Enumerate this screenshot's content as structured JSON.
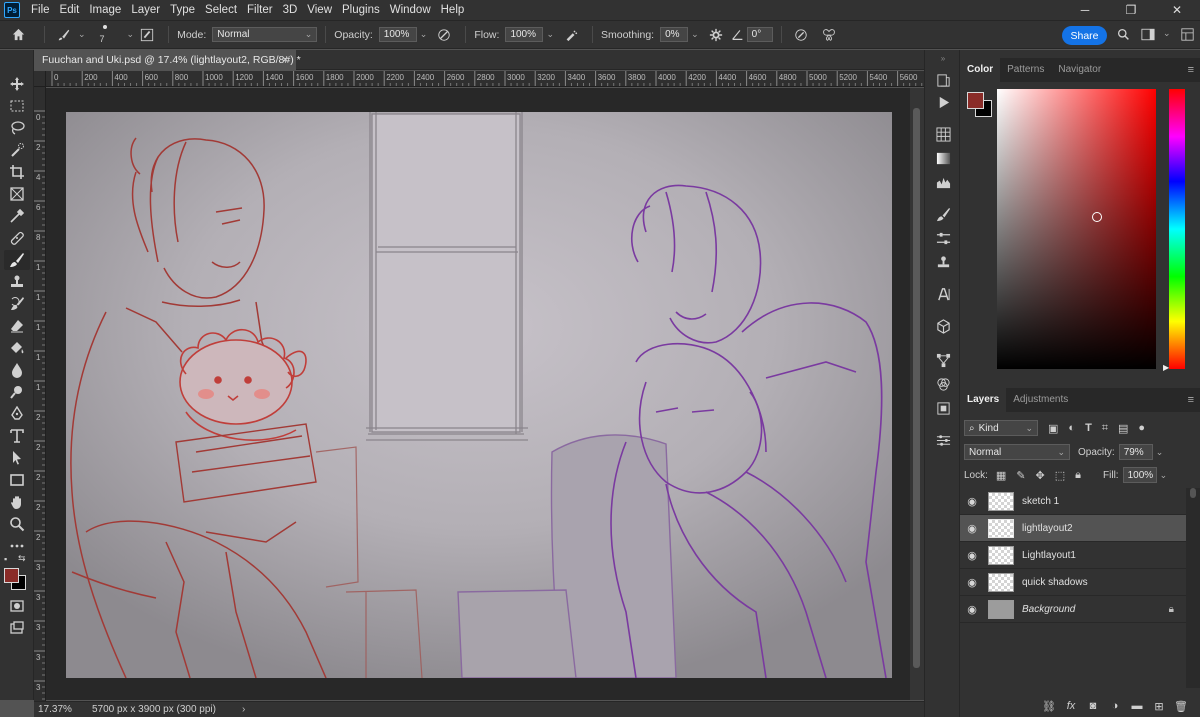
{
  "app": {
    "logo_text": "Ps",
    "menu": [
      "File",
      "Edit",
      "Image",
      "Layer",
      "Type",
      "Select",
      "Filter",
      "3D",
      "View",
      "Plugins",
      "Window",
      "Help"
    ]
  },
  "window_controls": {
    "minimize": "─",
    "maximize": "❐",
    "close": "✕"
  },
  "options_bar": {
    "brush_size": "7",
    "mode_label": "Mode:",
    "mode_value": "Normal",
    "opacity_label": "Opacity:",
    "opacity_value": "100%",
    "flow_label": "Flow:",
    "flow_value": "100%",
    "smoothing_label": "Smoothing:",
    "smoothing_value": "0%",
    "angle_value": "0°",
    "share_label": "Share"
  },
  "document": {
    "tab_title": "Fuuchan and Uki.psd @ 17.4% (lightlayout2, RGB/8#) *",
    "close_glyph": "×"
  },
  "ruler_h_labels": [
    "0",
    "200",
    "400",
    "600",
    "800",
    "1000",
    "1200",
    "1400",
    "1600",
    "1800",
    "2000",
    "2200",
    "2400",
    "2600",
    "2800",
    "3000",
    "3200",
    "3400",
    "3600",
    "3800",
    "4000",
    "4200",
    "4400",
    "4600",
    "4800",
    "5000",
    "5200",
    "5400",
    "5600"
  ],
  "ruler_v_labels": [
    "0",
    "2",
    "4",
    "6",
    "8",
    "1",
    "1",
    "1",
    "1",
    "1",
    "2",
    "2",
    "2",
    "2",
    "2",
    "3",
    "3",
    "3",
    "3",
    "3"
  ],
  "status": {
    "zoom": "17.37%",
    "doc_info": "5700 px x 3900 px (300 ppi)",
    "arrow": "›"
  },
  "color_panel": {
    "tabs": [
      "Color",
      "Patterns",
      "Navigator"
    ],
    "foreground": "#8a2c28",
    "background": "#000000",
    "hue": "#ff0000"
  },
  "layers_panel": {
    "tabs": [
      "Layers",
      "Adjustments"
    ],
    "filter_kind": "Kind",
    "blend_mode": "Normal",
    "opacity_label": "Opacity:",
    "opacity_value": "79%",
    "lock_label": "Lock:",
    "fill_label": "Fill:",
    "fill_value": "100%",
    "layers": [
      {
        "name": "sketch 1",
        "visible": true,
        "selected": false
      },
      {
        "name": "lightlayout2",
        "visible": true,
        "selected": true
      },
      {
        "name": "Lightlayout1",
        "visible": true,
        "selected": false
      },
      {
        "name": "quick shadows",
        "visible": true,
        "selected": false
      },
      {
        "name": "Background",
        "visible": true,
        "selected": false,
        "locked": true
      }
    ]
  },
  "icons": {
    "toolbar": [
      "move-icon",
      "marquee-icon",
      "lasso-icon",
      "quick-select-icon",
      "crop-icon",
      "frame-icon",
      "eyedropper-icon",
      "healing-brush-icon",
      "brush-icon",
      "clone-stamp-icon",
      "history-brush-icon",
      "eraser-icon",
      "paint-bucket-icon",
      "blur-icon",
      "dodge-icon",
      "pen-icon",
      "type-icon",
      "path-select-icon",
      "rectangle-icon",
      "hand-icon",
      "zoom-icon",
      "more-tools-icon"
    ]
  }
}
